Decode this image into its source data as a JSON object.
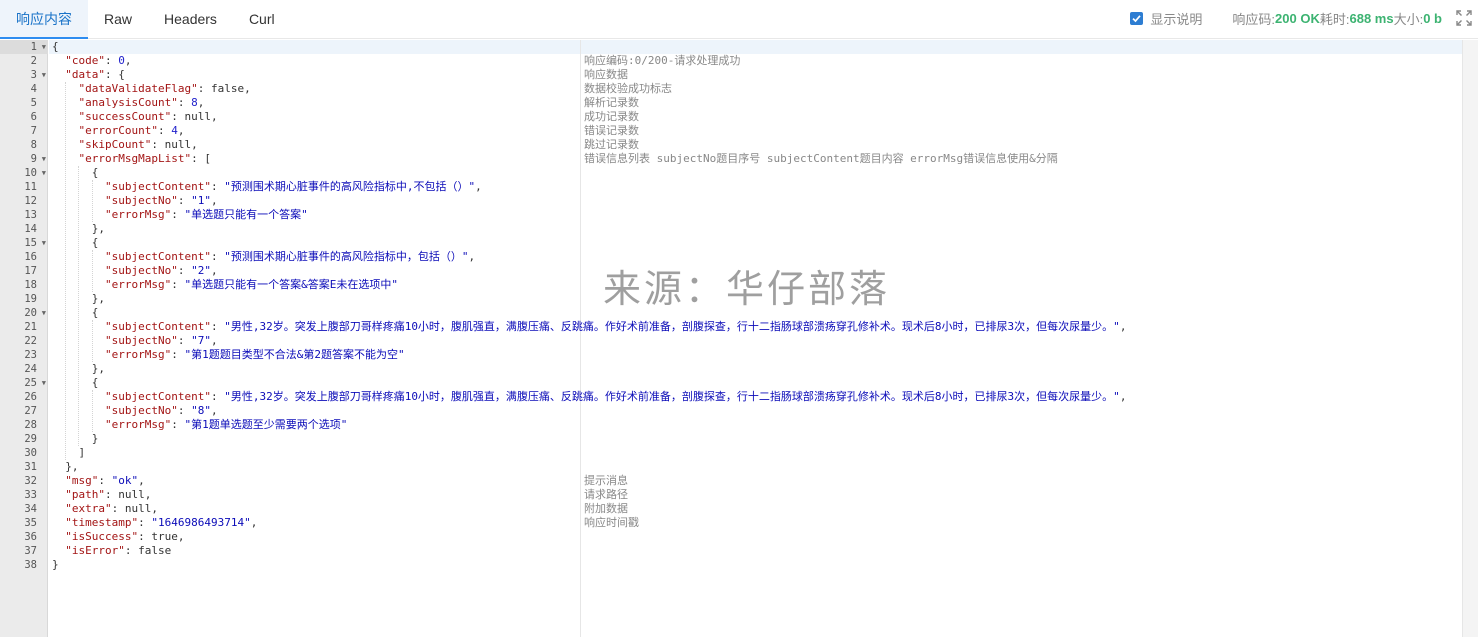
{
  "tabs": [
    {
      "label": "响应内容",
      "active": true
    },
    {
      "label": "Raw",
      "active": false
    },
    {
      "label": "Headers",
      "active": false
    },
    {
      "label": "Curl",
      "active": false
    }
  ],
  "status": {
    "show_desc_label": "显示说明",
    "show_desc_checked": true,
    "code_label": "响应码:",
    "code_value": "200 OK",
    "time_label": "耗时:",
    "time_value": "688 ms",
    "size_label": "大小:",
    "size_value": "0 b"
  },
  "editor": {
    "active_line": 1,
    "lines": [
      {
        "n": "1",
        "fold": true,
        "code": "{",
        "comment": ""
      },
      {
        "n": "2",
        "fold": false,
        "code": "  \"code\": 0,",
        "comment": "响应编码:0/200-请求处理成功"
      },
      {
        "n": "3",
        "fold": true,
        "code": "  \"data\": {",
        "comment": "响应数据"
      },
      {
        "n": "4",
        "fold": false,
        "code": "    \"dataValidateFlag\": false,",
        "comment": "数据校验成功标志"
      },
      {
        "n": "5",
        "fold": false,
        "code": "    \"analysisCount\": 8,",
        "comment": "解析记录数"
      },
      {
        "n": "6",
        "fold": false,
        "code": "    \"successCount\": null,",
        "comment": "成功记录数"
      },
      {
        "n": "7",
        "fold": false,
        "code": "    \"errorCount\": 4,",
        "comment": "错误记录数"
      },
      {
        "n": "8",
        "fold": false,
        "code": "    \"skipCount\": null,",
        "comment": "跳过记录数"
      },
      {
        "n": "9",
        "fold": true,
        "code": "    \"errorMsgMapList\": [",
        "comment": "错误信息列表 subjectNo题目序号 subjectContent题目内容 errorMsg错误信息使用&分隔"
      },
      {
        "n": "10",
        "fold": true,
        "code": "      {",
        "comment": ""
      },
      {
        "n": "11",
        "fold": false,
        "code": "        \"subjectContent\": \"预测围术期心脏事件的高风险指标中,不包括（）\",",
        "comment": ""
      },
      {
        "n": "12",
        "fold": false,
        "code": "        \"subjectNo\": \"1\",",
        "comment": ""
      },
      {
        "n": "13",
        "fold": false,
        "code": "        \"errorMsg\": \"单选题只能有一个答案\"",
        "comment": ""
      },
      {
        "n": "14",
        "fold": false,
        "code": "      },",
        "comment": ""
      },
      {
        "n": "15",
        "fold": true,
        "code": "      {",
        "comment": ""
      },
      {
        "n": "16",
        "fold": false,
        "code": "        \"subjectContent\": \"预测围术期心脏事件的高风险指标中，包括（）\",",
        "comment": ""
      },
      {
        "n": "17",
        "fold": false,
        "code": "        \"subjectNo\": \"2\",",
        "comment": ""
      },
      {
        "n": "18",
        "fold": false,
        "code": "        \"errorMsg\": \"单选题只能有一个答案&答案E未在选项中\"",
        "comment": ""
      },
      {
        "n": "19",
        "fold": false,
        "code": "      },",
        "comment": ""
      },
      {
        "n": "20",
        "fold": true,
        "code": "      {",
        "comment": ""
      },
      {
        "n": "21",
        "fold": false,
        "code": "        \"subjectContent\": \"男性,32岁。突发上腹部刀哥样疼痛10小时，腹肌强直，满腹压痛、反跳痛。作好术前准备，剖腹探查，行十二指肠球部溃疡穿孔修补术。现术后8小时，已排尿3次，但每次尿量少。\",",
        "comment": ""
      },
      {
        "n": "22",
        "fold": false,
        "code": "        \"subjectNo\": \"7\",",
        "comment": ""
      },
      {
        "n": "23",
        "fold": false,
        "code": "        \"errorMsg\": \"第1题题目类型不合法&第2题答案不能为空\"",
        "comment": ""
      },
      {
        "n": "24",
        "fold": false,
        "code": "      },",
        "comment": ""
      },
      {
        "n": "25",
        "fold": true,
        "code": "      {",
        "comment": ""
      },
      {
        "n": "26",
        "fold": false,
        "code": "        \"subjectContent\": \"男性,32岁。突发上腹部刀哥样疼痛10小时，腹肌强直，满腹压痛、反跳痛。作好术前准备，剖腹探查，行十二指肠球部溃疡穿孔修补术。现术后8小时，已排尿3次，但每次尿量少。\",",
        "comment": ""
      },
      {
        "n": "27",
        "fold": false,
        "code": "        \"subjectNo\": \"8\",",
        "comment": ""
      },
      {
        "n": "28",
        "fold": false,
        "code": "        \"errorMsg\": \"第1题单选题至少需要两个选项\"",
        "comment": ""
      },
      {
        "n": "29",
        "fold": false,
        "code": "      }",
        "comment": ""
      },
      {
        "n": "30",
        "fold": false,
        "code": "    ]",
        "comment": ""
      },
      {
        "n": "31",
        "fold": false,
        "code": "  },",
        "comment": ""
      },
      {
        "n": "32",
        "fold": false,
        "code": "  \"msg\": \"ok\",",
        "comment": "提示消息"
      },
      {
        "n": "33",
        "fold": false,
        "code": "  \"path\": null,",
        "comment": "请求路径"
      },
      {
        "n": "34",
        "fold": false,
        "code": "  \"extra\": null,",
        "comment": "附加数据"
      },
      {
        "n": "35",
        "fold": false,
        "code": "  \"timestamp\": \"1646986493714\",",
        "comment": "响应时间戳"
      },
      {
        "n": "36",
        "fold": false,
        "code": "  \"isSuccess\": true,",
        "comment": ""
      },
      {
        "n": "37",
        "fold": false,
        "code": "  \"isError\": false",
        "comment": ""
      },
      {
        "n": "38",
        "fold": false,
        "code": "}",
        "comment": ""
      }
    ]
  },
  "watermark": "来源：华仔部落",
  "colors": {
    "accent": "#2d8cf0",
    "status_green": "#3cb371",
    "json_key": "#a31515",
    "json_string": "#0b0bb8",
    "comment": "#888888"
  },
  "icons": {
    "checkbox": "checkbox-checked-icon",
    "fullscreen": "fullscreen-expand-icon",
    "fold": "fold-arrow-icon"
  }
}
